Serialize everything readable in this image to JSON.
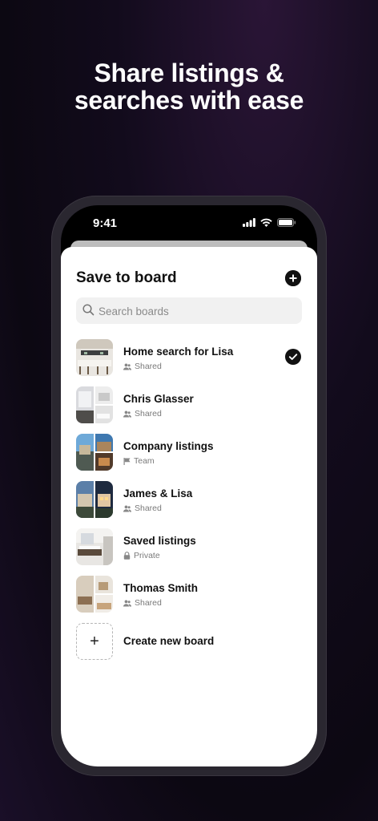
{
  "headline": {
    "line1": "Share listings &",
    "line2": "searches with ease"
  },
  "status_bar": {
    "time": "9:41"
  },
  "sheet": {
    "title": "Save to board",
    "add_icon": "plus-circle-icon"
  },
  "search": {
    "placeholder": "Search boards",
    "value": ""
  },
  "boards": [
    {
      "name": "Home search for Lisa",
      "meta": "Shared",
      "meta_icon": "people-icon",
      "selected": true
    },
    {
      "name": "Chris Glasser",
      "meta": "Shared",
      "meta_icon": "people-icon",
      "selected": false
    },
    {
      "name": "Company listings",
      "meta": "Team",
      "meta_icon": "flag-icon",
      "selected": false
    },
    {
      "name": "James & Lisa",
      "meta": "Shared",
      "meta_icon": "people-icon",
      "selected": false
    },
    {
      "name": "Saved listings",
      "meta": "Private",
      "meta_icon": "lock-icon",
      "selected": false
    },
    {
      "name": "Thomas Smith",
      "meta": "Shared",
      "meta_icon": "people-icon",
      "selected": false
    }
  ],
  "create": {
    "label": "Create new board",
    "symbol": "+"
  },
  "colors": {
    "background": "#120b1c",
    "sheet": "#ffffff",
    "accent": "#111111"
  }
}
